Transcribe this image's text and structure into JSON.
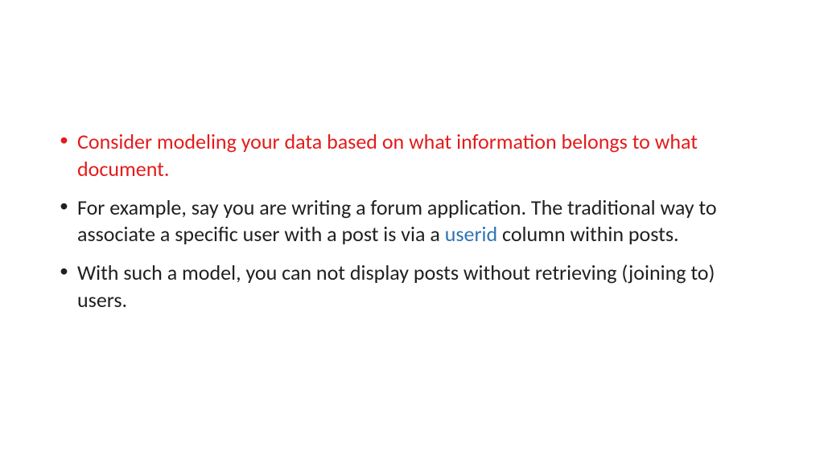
{
  "bullets": {
    "b1": "Consider modeling your data based on what information belongs to what document.",
    "b2a": "For example, say you are writing a forum application. The traditional way to associate a specific user with a post is via a ",
    "b2_userid": "userid",
    "b2b": " column within posts.",
    "b3": "With such a model, you can not display posts without retrieving (joining to) users."
  },
  "colors": {
    "red": "#e31b1b",
    "blue": "#2e74b5",
    "text": "#202020"
  }
}
